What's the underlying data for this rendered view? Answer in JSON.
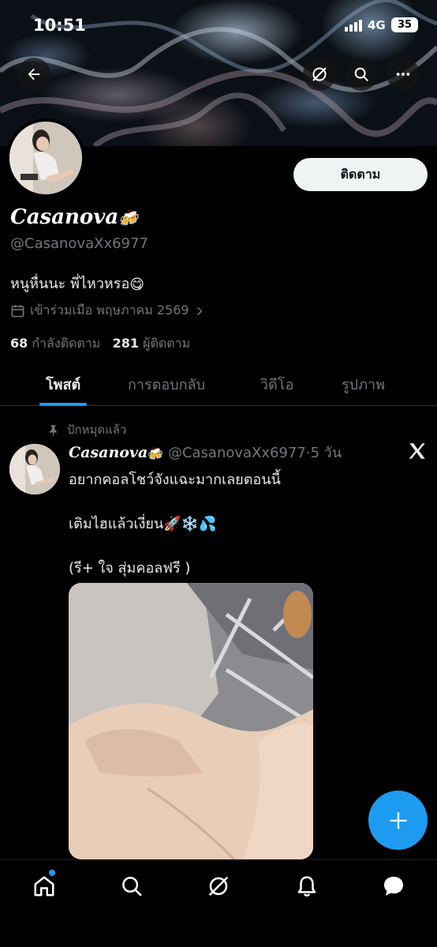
{
  "status_bar": {
    "time": "10:51",
    "network": "4G",
    "battery": "35"
  },
  "header": {
    "back_icon": "back-arrow-icon",
    "grok_icon": "grok-icon",
    "search_icon": "search-icon",
    "more_icon": "more-icon"
  },
  "profile": {
    "display_name": "Casanova",
    "name_emoji": "🍻",
    "handle": "@CasanovaXx6977",
    "follow_label": "ติดตาม",
    "bio": "หนูหื่นนะ พี่ไหวหรอ",
    "bio_emoji": "😋",
    "joined": "เข้าร่วมเมือ พฤษภาคม 2569",
    "following_count": "68",
    "following_label": "กำลังติดตาม",
    "followers_count": "281",
    "followers_label": "ผู้ติดตาม"
  },
  "tabs": [
    {
      "label": "โพสต์",
      "active": true
    },
    {
      "label": "การตอบกลับ",
      "active": false
    },
    {
      "label": "วิดีโอ",
      "active": false
    },
    {
      "label": "รูปภาพ",
      "active": false
    }
  ],
  "post": {
    "pinned_label": "ปักหมุดแล้ว",
    "author_name": "Casanova",
    "author_emoji": "🍻",
    "author_handle": "@CasanovaXx6977",
    "separator": "·",
    "time_ago": "5 วัน",
    "line1": "อยากคอลโชว์จังแฉะมากเลยตอนนี้",
    "line2": "เติมไฮแล้วเงี่ยน",
    "line2_emojis": "🚀❄️💦",
    "line3": "(รี+ ใจ สุ่มคอลฟรี )"
  },
  "colors": {
    "accent": "#1d9bf0",
    "background": "#000000",
    "muted": "#71767b",
    "text": "#e7e9ea"
  },
  "bottom_nav": [
    "home-icon",
    "search-icon",
    "grok-icon",
    "notifications-icon",
    "messages-icon"
  ]
}
